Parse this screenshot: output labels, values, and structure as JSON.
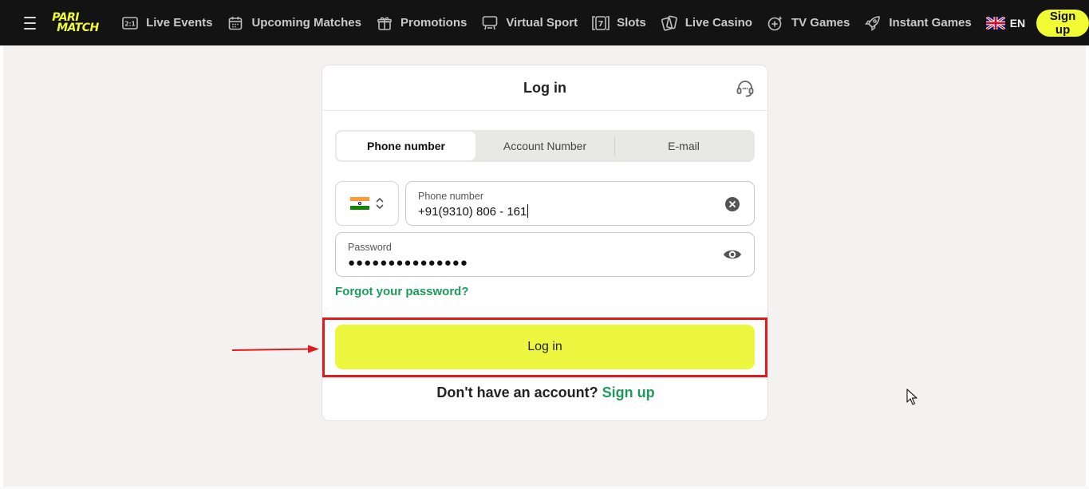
{
  "brand": {
    "logo_line1": "PARI",
    "logo_line2": "MATCH",
    "accent": "#f1fb34"
  },
  "nav": {
    "items": [
      {
        "label": "Live Events",
        "icon": "score-icon"
      },
      {
        "label": "Upcoming Matches",
        "icon": "calendar-icon"
      },
      {
        "label": "Promotions",
        "icon": "gift-icon"
      },
      {
        "label": "Virtual Sport",
        "icon": "gamepad-icon"
      },
      {
        "label": "Slots",
        "icon": "slot-seven-icon"
      },
      {
        "label": "Live Casino",
        "icon": "cards-icon"
      },
      {
        "label": "TV Games",
        "icon": "tv-games-icon"
      },
      {
        "label": "Instant Games",
        "icon": "rocket-icon"
      }
    ],
    "language": "EN",
    "signup_label": "Sign up"
  },
  "login": {
    "title": "Log in",
    "tabs": [
      {
        "label": "Phone number",
        "active": true
      },
      {
        "label": "Account Number",
        "active": false
      },
      {
        "label": "E-mail",
        "active": false
      }
    ],
    "phone": {
      "label": "Phone number",
      "value": "+91(9310) 806 - 161"
    },
    "password": {
      "label": "Password",
      "value": "●●●●●●●●●●●●●●●"
    },
    "forgot_label": "Forgot your password?",
    "submit_label": "Log in",
    "no_account_text": "Don't have an account?",
    "signup_link": "Sign up"
  },
  "colors": {
    "primary_button": "#eef73f",
    "link_green": "#1d9a5b",
    "highlight_red": "#e01b1b"
  }
}
